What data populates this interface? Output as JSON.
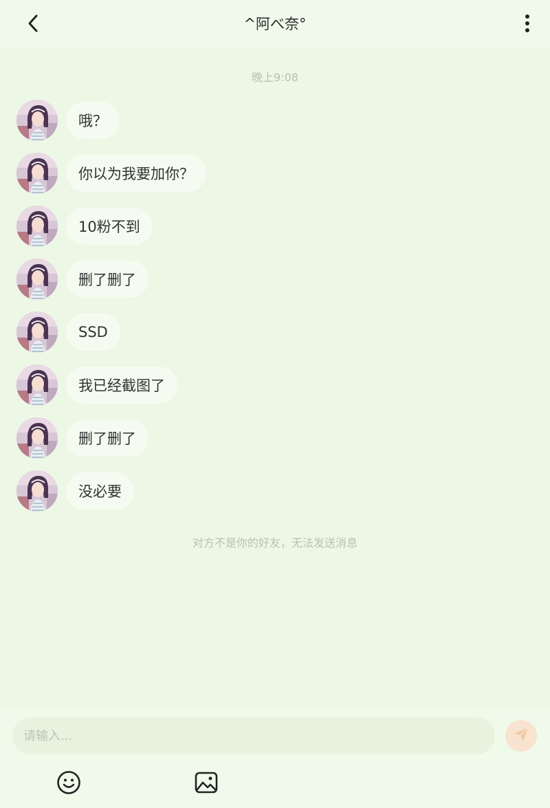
{
  "header": {
    "title": "^阿べ奈°",
    "back_icon": "chevron-left-icon",
    "more_icon": "more-vertical-icon"
  },
  "chat": {
    "timestamp": "晚上9:08",
    "messages": [
      {
        "text": "哦？"
      },
      {
        "text": "你以为我要加你？"
      },
      {
        "text": "10粉不到"
      },
      {
        "text": "删了删了"
      },
      {
        "text": "SSD"
      },
      {
        "text": "我已经截图了"
      },
      {
        "text": "删了删了"
      },
      {
        "text": "没必要"
      }
    ],
    "notice": "对方不是你的好友，无法发送消息"
  },
  "composer": {
    "placeholder": "请输入...",
    "send_icon": "send-icon",
    "emoji_icon": "emoji-icon",
    "image_icon": "image-icon"
  },
  "colors": {
    "background": "#edf7e6",
    "bubble": "#f5fbf0",
    "send_button": "#f7e3cf"
  }
}
